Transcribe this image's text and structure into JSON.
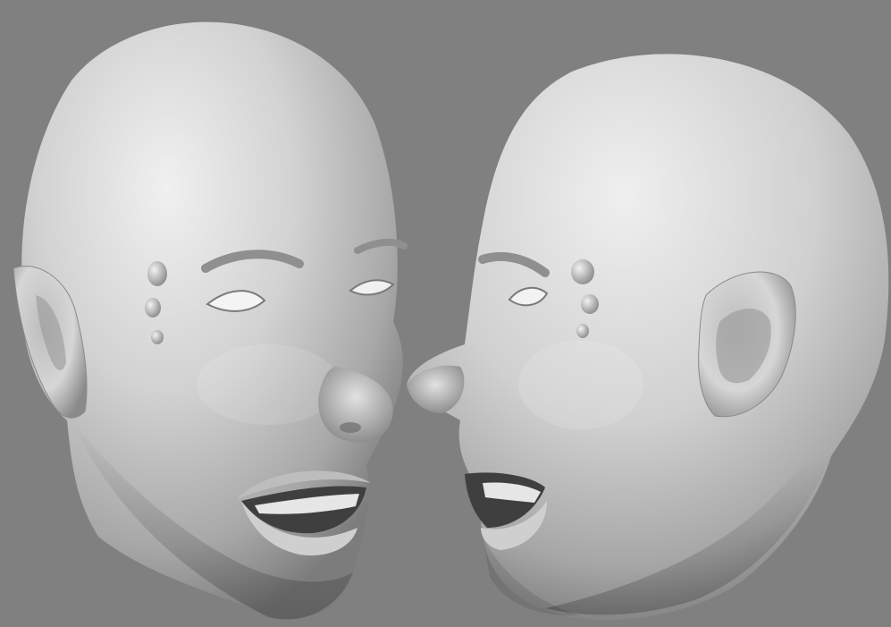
{
  "scene": {
    "background_color": "#808080",
    "clay_light": "#e9e9e9",
    "clay_mid": "#b9b9b9",
    "clay_dark": "#6a6a6a",
    "objects": [
      {
        "name": "left-head",
        "description_icon": "sculpted-head-icon"
      },
      {
        "name": "right-head",
        "description_icon": "sculpted-head-icon"
      }
    ]
  }
}
